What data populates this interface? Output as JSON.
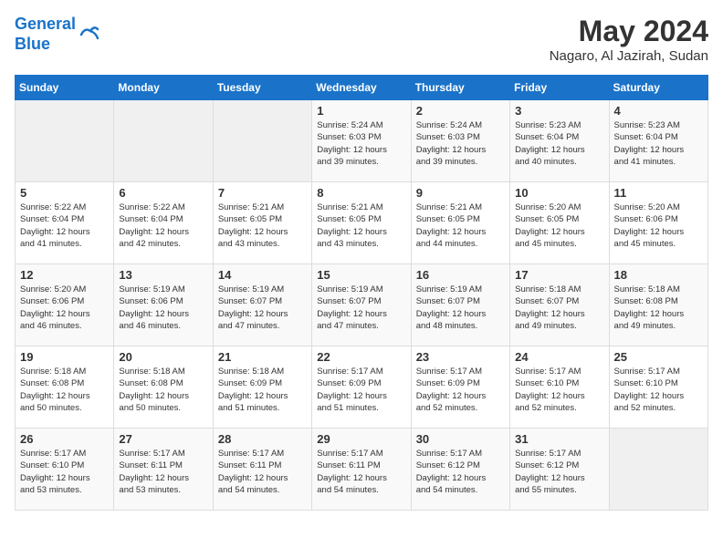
{
  "header": {
    "logo_line1": "General",
    "logo_line2": "Blue",
    "month_year": "May 2024",
    "location": "Nagaro, Al Jazirah, Sudan"
  },
  "days_of_week": [
    "Sunday",
    "Monday",
    "Tuesday",
    "Wednesday",
    "Thursday",
    "Friday",
    "Saturday"
  ],
  "weeks": [
    [
      {
        "day": "",
        "info": ""
      },
      {
        "day": "",
        "info": ""
      },
      {
        "day": "",
        "info": ""
      },
      {
        "day": "1",
        "info": "Sunrise: 5:24 AM\nSunset: 6:03 PM\nDaylight: 12 hours\nand 39 minutes."
      },
      {
        "day": "2",
        "info": "Sunrise: 5:24 AM\nSunset: 6:03 PM\nDaylight: 12 hours\nand 39 minutes."
      },
      {
        "day": "3",
        "info": "Sunrise: 5:23 AM\nSunset: 6:04 PM\nDaylight: 12 hours\nand 40 minutes."
      },
      {
        "day": "4",
        "info": "Sunrise: 5:23 AM\nSunset: 6:04 PM\nDaylight: 12 hours\nand 41 minutes."
      }
    ],
    [
      {
        "day": "5",
        "info": "Sunrise: 5:22 AM\nSunset: 6:04 PM\nDaylight: 12 hours\nand 41 minutes."
      },
      {
        "day": "6",
        "info": "Sunrise: 5:22 AM\nSunset: 6:04 PM\nDaylight: 12 hours\nand 42 minutes."
      },
      {
        "day": "7",
        "info": "Sunrise: 5:21 AM\nSunset: 6:05 PM\nDaylight: 12 hours\nand 43 minutes."
      },
      {
        "day": "8",
        "info": "Sunrise: 5:21 AM\nSunset: 6:05 PM\nDaylight: 12 hours\nand 43 minutes."
      },
      {
        "day": "9",
        "info": "Sunrise: 5:21 AM\nSunset: 6:05 PM\nDaylight: 12 hours\nand 44 minutes."
      },
      {
        "day": "10",
        "info": "Sunrise: 5:20 AM\nSunset: 6:05 PM\nDaylight: 12 hours\nand 45 minutes."
      },
      {
        "day": "11",
        "info": "Sunrise: 5:20 AM\nSunset: 6:06 PM\nDaylight: 12 hours\nand 45 minutes."
      }
    ],
    [
      {
        "day": "12",
        "info": "Sunrise: 5:20 AM\nSunset: 6:06 PM\nDaylight: 12 hours\nand 46 minutes."
      },
      {
        "day": "13",
        "info": "Sunrise: 5:19 AM\nSunset: 6:06 PM\nDaylight: 12 hours\nand 46 minutes."
      },
      {
        "day": "14",
        "info": "Sunrise: 5:19 AM\nSunset: 6:07 PM\nDaylight: 12 hours\nand 47 minutes."
      },
      {
        "day": "15",
        "info": "Sunrise: 5:19 AM\nSunset: 6:07 PM\nDaylight: 12 hours\nand 47 minutes."
      },
      {
        "day": "16",
        "info": "Sunrise: 5:19 AM\nSunset: 6:07 PM\nDaylight: 12 hours\nand 48 minutes."
      },
      {
        "day": "17",
        "info": "Sunrise: 5:18 AM\nSunset: 6:07 PM\nDaylight: 12 hours\nand 49 minutes."
      },
      {
        "day": "18",
        "info": "Sunrise: 5:18 AM\nSunset: 6:08 PM\nDaylight: 12 hours\nand 49 minutes."
      }
    ],
    [
      {
        "day": "19",
        "info": "Sunrise: 5:18 AM\nSunset: 6:08 PM\nDaylight: 12 hours\nand 50 minutes."
      },
      {
        "day": "20",
        "info": "Sunrise: 5:18 AM\nSunset: 6:08 PM\nDaylight: 12 hours\nand 50 minutes."
      },
      {
        "day": "21",
        "info": "Sunrise: 5:18 AM\nSunset: 6:09 PM\nDaylight: 12 hours\nand 51 minutes."
      },
      {
        "day": "22",
        "info": "Sunrise: 5:17 AM\nSunset: 6:09 PM\nDaylight: 12 hours\nand 51 minutes."
      },
      {
        "day": "23",
        "info": "Sunrise: 5:17 AM\nSunset: 6:09 PM\nDaylight: 12 hours\nand 52 minutes."
      },
      {
        "day": "24",
        "info": "Sunrise: 5:17 AM\nSunset: 6:10 PM\nDaylight: 12 hours\nand 52 minutes."
      },
      {
        "day": "25",
        "info": "Sunrise: 5:17 AM\nSunset: 6:10 PM\nDaylight: 12 hours\nand 52 minutes."
      }
    ],
    [
      {
        "day": "26",
        "info": "Sunrise: 5:17 AM\nSunset: 6:10 PM\nDaylight: 12 hours\nand 53 minutes."
      },
      {
        "day": "27",
        "info": "Sunrise: 5:17 AM\nSunset: 6:11 PM\nDaylight: 12 hours\nand 53 minutes."
      },
      {
        "day": "28",
        "info": "Sunrise: 5:17 AM\nSunset: 6:11 PM\nDaylight: 12 hours\nand 54 minutes."
      },
      {
        "day": "29",
        "info": "Sunrise: 5:17 AM\nSunset: 6:11 PM\nDaylight: 12 hours\nand 54 minutes."
      },
      {
        "day": "30",
        "info": "Sunrise: 5:17 AM\nSunset: 6:12 PM\nDaylight: 12 hours\nand 54 minutes."
      },
      {
        "day": "31",
        "info": "Sunrise: 5:17 AM\nSunset: 6:12 PM\nDaylight: 12 hours\nand 55 minutes."
      },
      {
        "day": "",
        "info": ""
      }
    ]
  ]
}
